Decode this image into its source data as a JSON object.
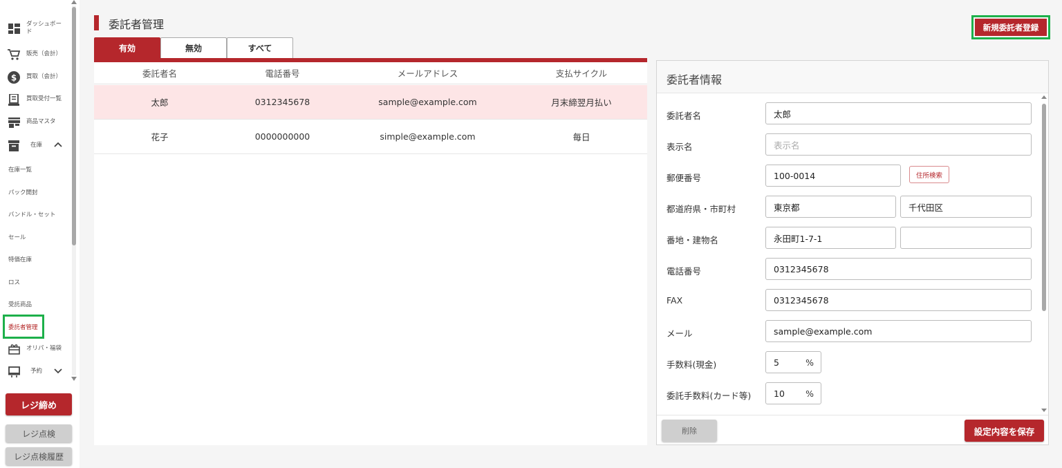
{
  "sidebar": {
    "items": [
      {
        "label": "ダッシュボード",
        "icon": "dashboard-icon"
      },
      {
        "label": "販売（会計）",
        "icon": "cart-icon"
      },
      {
        "label": "買取（会計）",
        "icon": "dollar-icon"
      },
      {
        "label": "買取受付一覧",
        "icon": "receipt-icon"
      },
      {
        "label": "商品マスタ",
        "icon": "store-icon"
      },
      {
        "label": "在庫",
        "icon": "archive-icon"
      }
    ],
    "stock_sub": [
      "在庫一覧",
      "パック開封",
      "バンドル・セット",
      "セール",
      "特価在庫",
      "ロス",
      "受託商品",
      "委託者管理"
    ],
    "oripa": {
      "label": "オリパ・福袋",
      "icon": "gift-icon"
    },
    "reserve": {
      "label": "予約",
      "icon": "monitor-icon"
    },
    "close_register": "レジ締め",
    "register_check": "レジ点検",
    "register_history": "レジ点検履歴"
  },
  "header": {
    "title": "委託者管理",
    "new_button": "新規委託者登録"
  },
  "tabs": [
    "有効",
    "無効",
    "すべて"
  ],
  "table": {
    "columns": [
      "委託者名",
      "電話番号",
      "メールアドレス",
      "支払サイクル"
    ],
    "rows": [
      [
        "太郎",
        "0312345678",
        "sample@example.com",
        "月末締翌月払い"
      ],
      [
        "花子",
        "0000000000",
        "simple@example.com",
        "毎日"
      ]
    ]
  },
  "detail": {
    "title": "委託者情報",
    "labels": {
      "name": "委託者名",
      "display_name": "表示名",
      "postal": "郵便番号",
      "prefecture_city": "都道府県・市町村",
      "address": "番地・建物名",
      "phone": "電話番号",
      "fax": "FAX",
      "mail": "メール",
      "fee_cash": "手数料(現金)",
      "fee_card": "委託手数料(カード等)"
    },
    "values": {
      "name": "太郎",
      "display_name_placeholder": "表示名",
      "postal": "100-0014",
      "prefecture": "東京都",
      "city": "千代田区",
      "address1": "永田町1-7-1",
      "address2": "",
      "phone": "0312345678",
      "fax": "0312345678",
      "mail": "sample@example.com",
      "fee_cash": "5",
      "fee_card": "10",
      "percent": "%"
    },
    "address_search": "住所検索",
    "delete": "削除",
    "save": "設定内容を保存"
  },
  "colors": {
    "accent": "#b5272c",
    "highlight": "#1db04a",
    "selected_row": "#fde5e6"
  }
}
